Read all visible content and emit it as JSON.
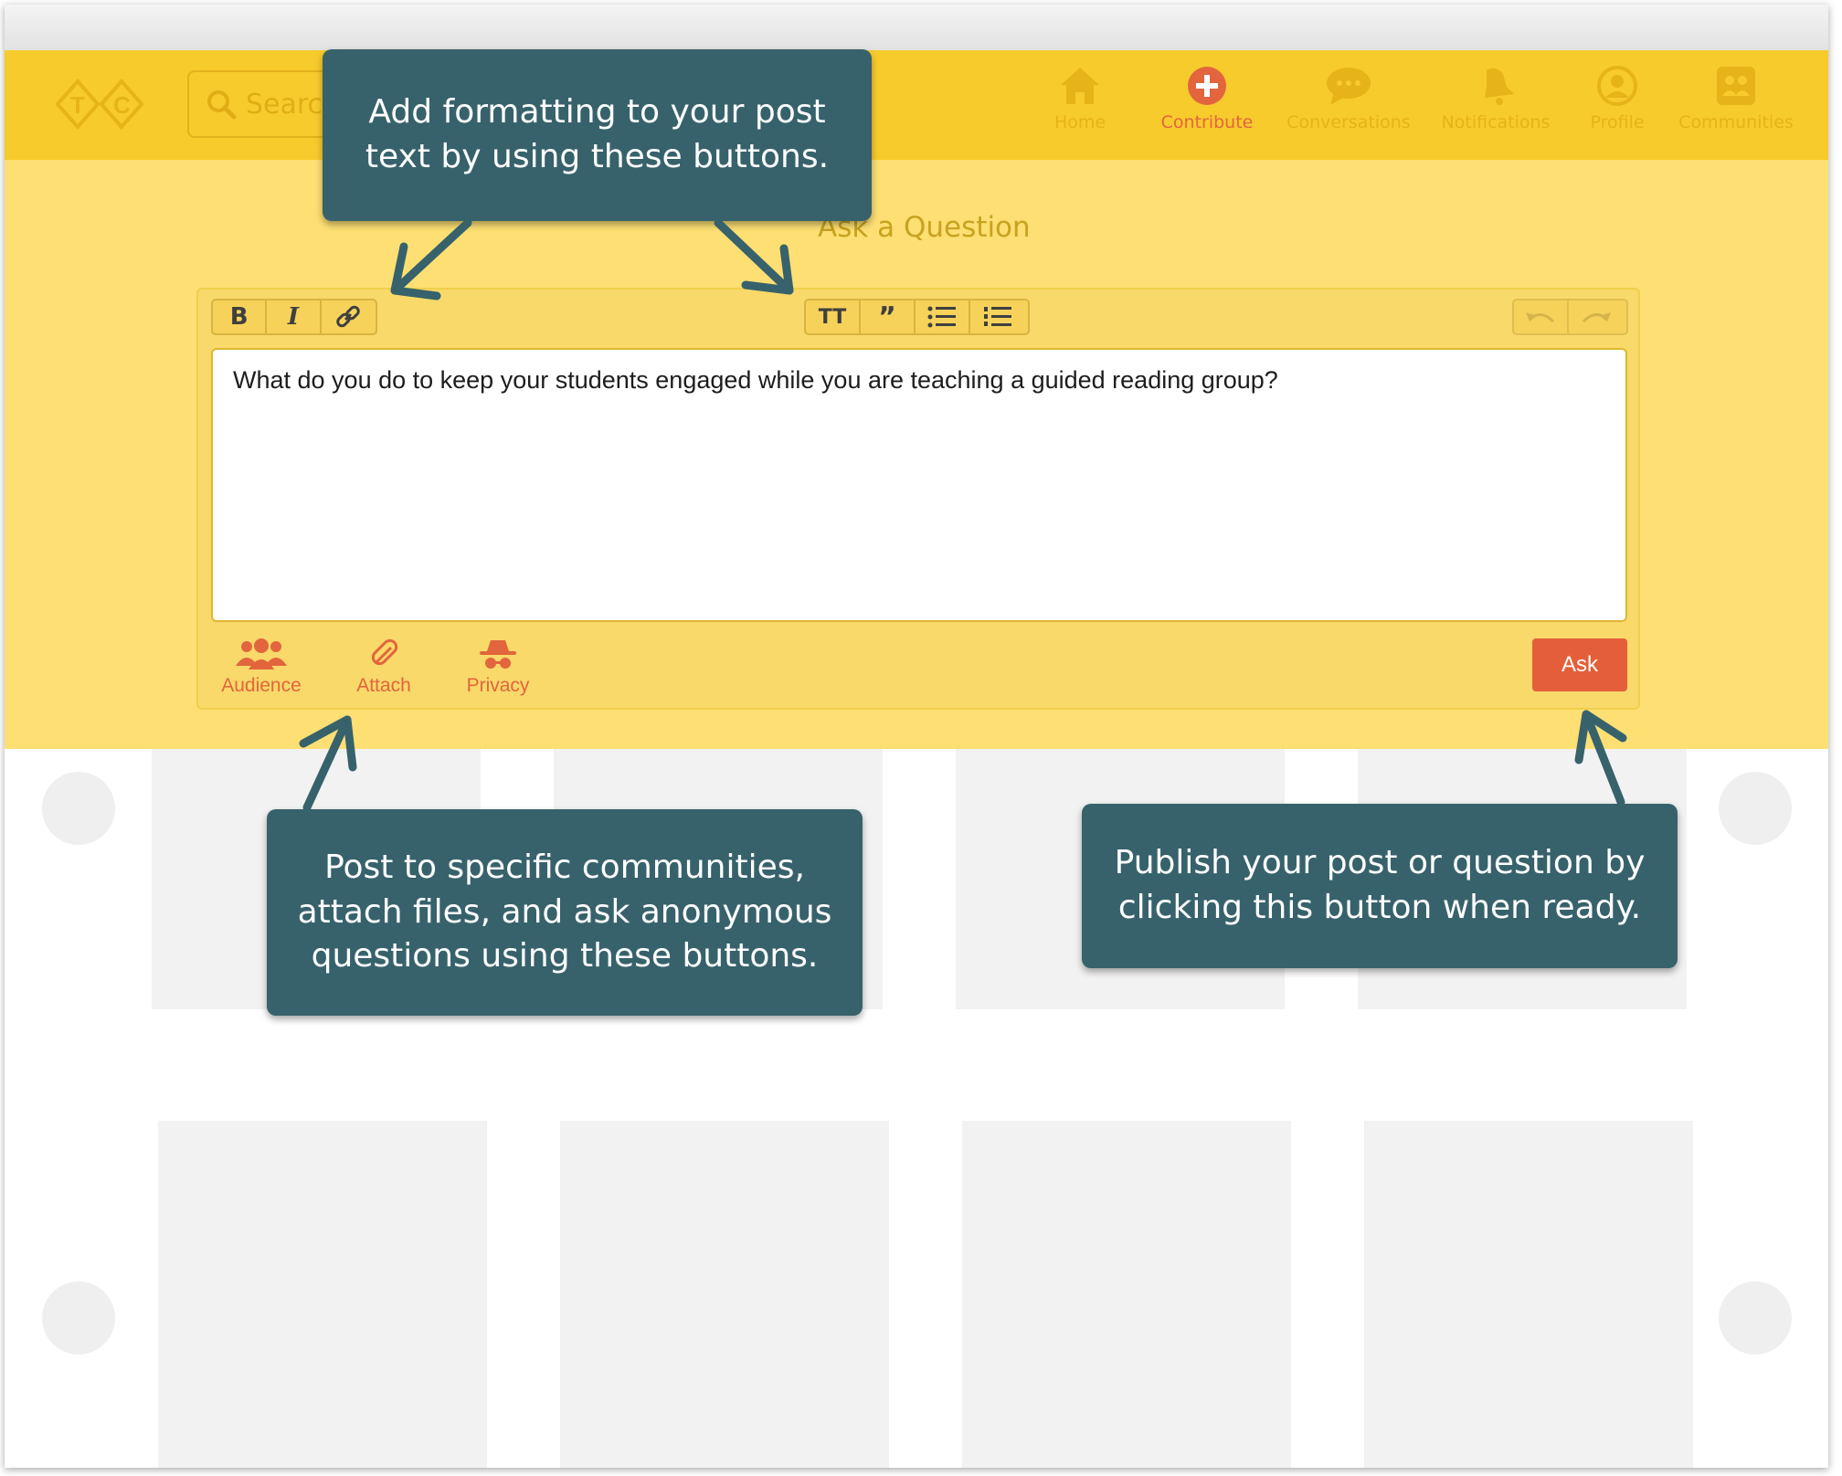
{
  "navbar": {
    "logo_text": "T C",
    "search_placeholder": "Search",
    "items": [
      {
        "label": "Home",
        "icon": "home-icon"
      },
      {
        "label": "Contribute",
        "icon": "plus-circle-icon",
        "active": true
      },
      {
        "label": "Conversations",
        "icon": "chat-bubble-icon"
      },
      {
        "label": "Notifications",
        "icon": "bell-icon"
      },
      {
        "label": "Profile",
        "icon": "user-icon"
      },
      {
        "label": "Communities",
        "icon": "communities-icon"
      }
    ]
  },
  "composer": {
    "title": "Ask a Question",
    "text": "What do you do to keep your students engaged while you are teaching a guided reading group?",
    "format_buttons": [
      "bold",
      "italic",
      "link"
    ],
    "block_buttons": [
      "text-size",
      "quote",
      "bullet-list",
      "numbered-list"
    ],
    "history_buttons": [
      "undo",
      "redo"
    ],
    "actions": [
      {
        "label": "Audience",
        "icon": "group-icon"
      },
      {
        "label": "Attach",
        "icon": "paperclip-icon"
      },
      {
        "label": "Privacy",
        "icon": "spy-icon"
      }
    ],
    "submit_label": "Ask"
  },
  "callouts": {
    "formatting": "Add formatting to your post\ntext by using these buttons.",
    "actions": "Post to specific communities,\nattach files, and ask anonymous\nquestions using these buttons.",
    "publish": "Publish your post or question by\nclicking this button when ready."
  },
  "colors": {
    "navbar": "#f8cb2c",
    "hero": "#fddf73",
    "accent": "#e45f39",
    "callout": "#37626c"
  }
}
